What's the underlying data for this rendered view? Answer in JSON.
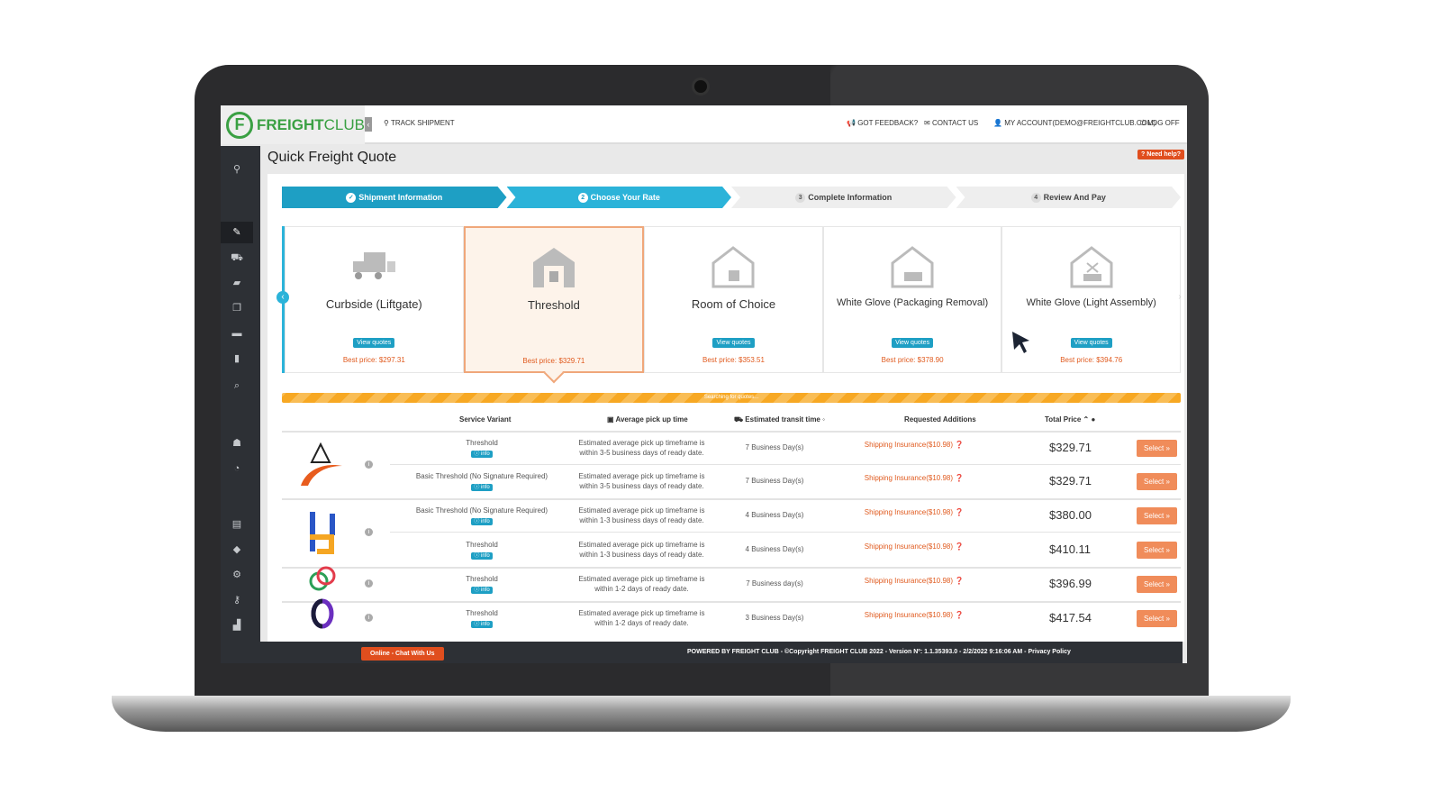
{
  "header": {
    "brand": "FREIGHT",
    "brand2": "CLUB",
    "track": "TRACK SHIPMENT",
    "feedback": "GOT FEEDBACK?",
    "contact": "CONTACT US",
    "account": "MY ACCOUNT(demo@freightclub.com)",
    "logoff": "LOG OFF"
  },
  "page": {
    "title": "Quick Freight Quote",
    "help": "Need help?"
  },
  "steps": [
    {
      "num": "✓",
      "label": "Shipment Information"
    },
    {
      "num": "2",
      "label": "Choose Your Rate"
    },
    {
      "num": "3",
      "label": "Complete Information"
    },
    {
      "num": "4",
      "label": "Review And Pay"
    }
  ],
  "cards": [
    {
      "name": "Curbside (Liftgate)",
      "button": "View quotes",
      "best": "Best price: $297.31"
    },
    {
      "name": "Threshold",
      "button": "View quotes",
      "best": "Best price: $329.71"
    },
    {
      "name": "Room of Choice",
      "button": "View quotes",
      "best": "Best price: $353.51"
    },
    {
      "name": "White Glove (Packaging Removal)",
      "button": "View quotes",
      "best": "Best price: $378.90"
    },
    {
      "name": "White Glove (Light Assembly)",
      "button": "View quotes",
      "best": "Best price: $394.76"
    }
  ],
  "progress": {
    "label": "Searching for quotes..."
  },
  "table": {
    "headers": {
      "variant": "Service Variant",
      "pickup": "Average pick up time",
      "transit": "Estimated transit time",
      "additions": "Requested Additions",
      "price": "Total Price"
    },
    "info_label": "info",
    "select_label": "Select »",
    "rows": [
      {
        "variant": "Threshold",
        "pickup1": "Estimated average pick up timeframe is",
        "pickup2": "within 3-5 business days of ready date.",
        "transit": "7 Business Day(s)",
        "addition": "Shipping Insurance($10.98)",
        "price": "$329.71"
      },
      {
        "variant": "Basic Threshold (No Signature Required)",
        "pickup1": "Estimated average pick up timeframe is",
        "pickup2": "within 3-5 business days of ready date.",
        "transit": "7 Business Day(s)",
        "addition": "Shipping Insurance($10.98)",
        "price": "$329.71"
      },
      {
        "variant": "Basic Threshold (No Signature Required)",
        "pickup1": "Estimated average pick up timeframe is",
        "pickup2": "within 1-3 business days of ready date.",
        "transit": "4 Business Day(s)",
        "addition": "Shipping Insurance($10.98)",
        "price": "$380.00"
      },
      {
        "variant": "Threshold",
        "pickup1": "Estimated average pick up timeframe is",
        "pickup2": "within 1-3 business days of ready date.",
        "transit": "4 Business Day(s)",
        "addition": "Shipping Insurance($10.98)",
        "price": "$410.11"
      },
      {
        "variant": "Threshold",
        "pickup1": "Estimated average pick up timeframe is",
        "pickup2": "within 1-2 days of ready date.",
        "transit": "7 Business day(s)",
        "addition": "Shipping Insurance($10.98)",
        "price": "$396.99"
      },
      {
        "variant": "Threshold",
        "pickup1": "Estimated average pick up timeframe is",
        "pickup2": "within 1-2 days of ready date.",
        "transit": "3 Business Day(s)",
        "addition": "Shipping Insurance($10.98)",
        "price": "$417.54"
      }
    ]
  },
  "footer": {
    "chat": "Online - Chat With Us",
    "copyright": "POWERED BY FREIGHT CLUB - ©Copyright FREIGHT CLUB 2022 - Version Nº: 1.1.35393.0 - 2/2/2022 9:16:06 AM -",
    "privacy": "Privacy Policy"
  },
  "colors": {
    "brand": "#3aa043",
    "accent": "#1e9fc4",
    "orange": "#f08c5a"
  }
}
